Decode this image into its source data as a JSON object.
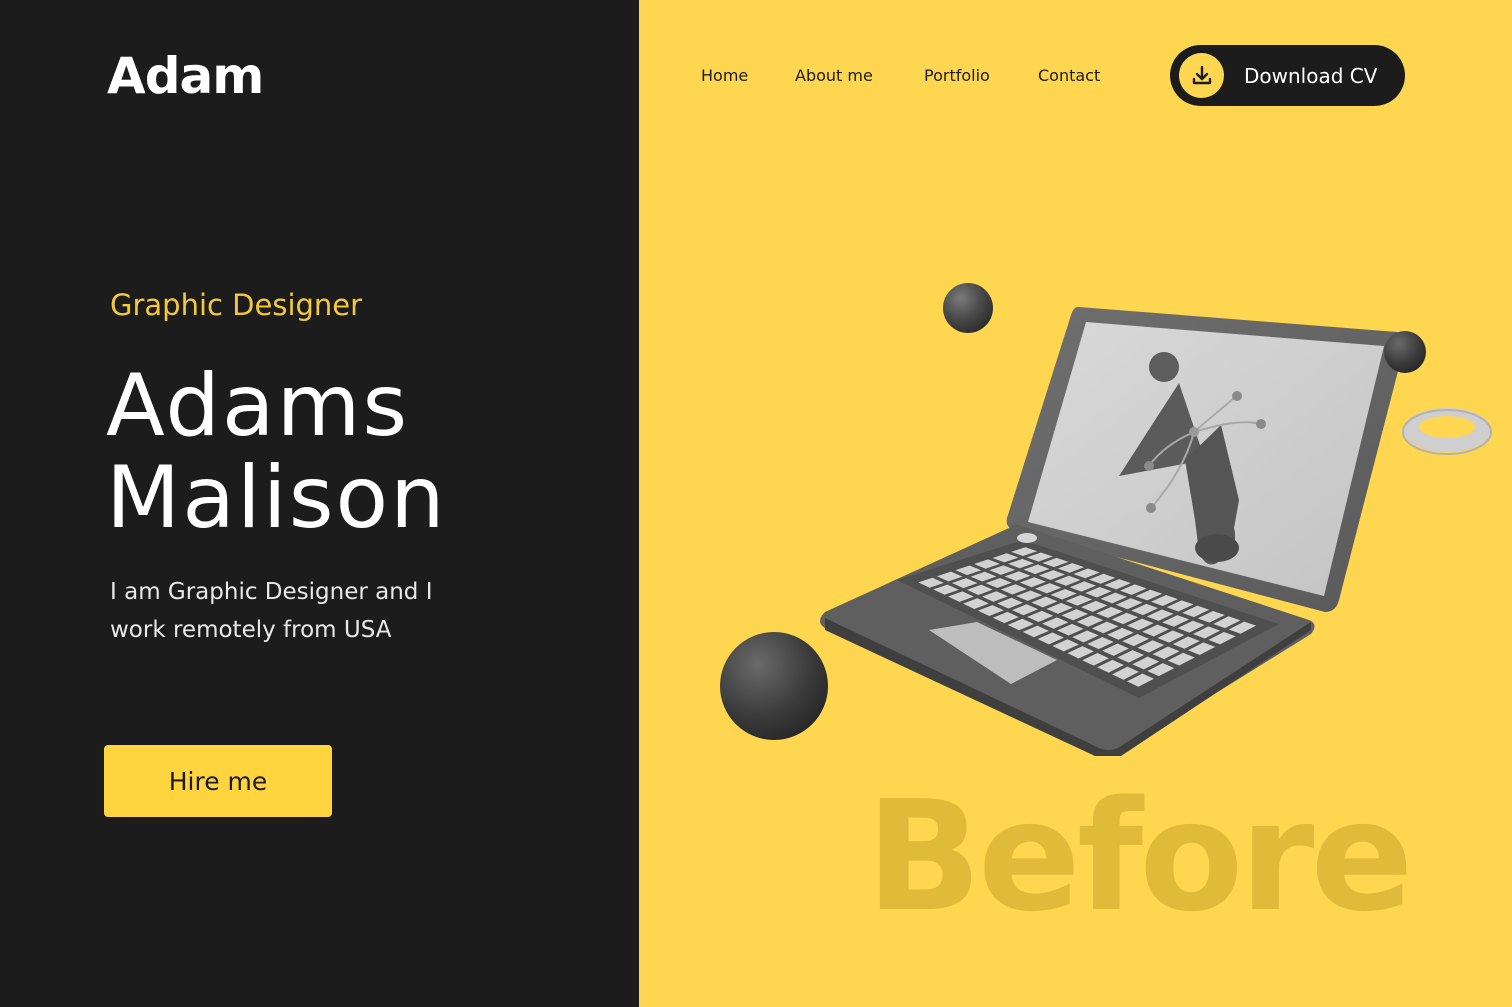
{
  "brand": {
    "logo": "Adam"
  },
  "hero": {
    "role": "Graphic Designer",
    "first_name": "Adams",
    "last_name": "Malison",
    "description": "I am Graphic Designer and I work remotely from USA",
    "cta_label": "Hire me"
  },
  "nav": {
    "items": [
      {
        "label": "Home"
      },
      {
        "label": "About me"
      },
      {
        "label": "Portfolio"
      },
      {
        "label": "Contact"
      }
    ],
    "download_label": "Download CV",
    "download_icon": "download-icon"
  },
  "illustration": {
    "subject": "laptop-3d-icon",
    "watermark": "Before"
  },
  "colors": {
    "dark_panel": "#1d1c1d",
    "accent_yellow": "#ffd64f",
    "role_yellow": "#f5c93d",
    "watermark": "#e0bb3a"
  }
}
